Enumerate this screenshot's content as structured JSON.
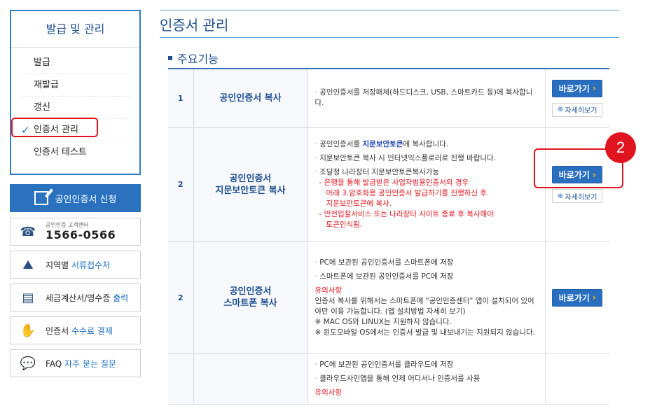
{
  "sidebar": {
    "title": "발급 및 관리",
    "items": [
      {
        "label": "발급"
      },
      {
        "label": "재발급"
      },
      {
        "label": "갱신"
      },
      {
        "label": "인증서 관리"
      },
      {
        "label": "인증서 테스트"
      }
    ],
    "active_mark": "✓",
    "apply_button": "공인인증서 신청",
    "callcenter": {
      "label": "공인인증 고객센터",
      "number": "1566-0566"
    },
    "links": [
      {
        "text": "지역별 ",
        "highlight": "서류접수처"
      },
      {
        "text": "세금계산서/영수증 ",
        "highlight": "출력"
      },
      {
        "text": "인증서 ",
        "highlight": "수수료 결제"
      },
      {
        "text": "FAQ ",
        "highlight": "자주 묻는 질문"
      }
    ]
  },
  "main": {
    "title": "인증서 관리",
    "section": "주요기능",
    "go_label": "바로가기",
    "go_arrow": "›",
    "detail_label": "자세히보기",
    "rows": [
      {
        "num": "1",
        "name": "공인인증서 복사",
        "desc": "공인인증서를 저장매체(하드디스크, USB, 스마트카드 등)에 복사합니다."
      },
      {
        "num": "2",
        "name1": "공인인증서",
        "name2": "지문보안토큰 복사",
        "d1a": "공인인증서를 ",
        "d1b": "지문보안토큰",
        "d1c": "에 복사합니다.",
        "d2": "지문보안토큰 복사 시 인터넷익스플로러로 진행 바랍니다.",
        "d3": "조달청 나라장터 지문보안토큰복사가능",
        "r1": "- 은행을 통해 발급받은 사업자범용인증서의 경우",
        "r2": "아래 3.암호화용 공인인증서 발급하기를 진행하신 후",
        "r3": "지문보안토큰에 복사.",
        "r4": "- 안전입찰서비스 또는 나라장터 사이트 종료 후 복사해야",
        "r5": "토큰인식됨."
      },
      {
        "num": "2",
        "name1": "공인인증서",
        "name2": "스마트폰 복사",
        "d1": "PC에 보관된 공인인증서를 스마트폰에 저장",
        "d2": "스마트폰에 보관된 공인인증서를 PC에 저장",
        "note_title": "유의사항",
        "n1": "인증서 복사를 위해서는 스마트폰에 \"공인인증센터\" 앱이 설치되어 있어야만 이용 가능합니다. (앱 설치방법 자세히 보기)",
        "n2": "※ MAC OS와 LINUX는 지원하지 않습니다.",
        "n3": "※ 윈도모바일 OS에서는 인증서 발급 및 내보내기는 지원되지 않습니다."
      },
      {
        "d1": "PC에 보관된 공인인증서를 클라우드에 저장",
        "d2": "클라우드사인앱을 통해 언제 어디서나 인증서를 사용",
        "note_title": "유의사항"
      }
    ]
  },
  "annotation": {
    "badge": "2"
  },
  "colors": {
    "primary": "#2a6fbf",
    "title": "#1f4f8f",
    "highlight": "#e0141e"
  }
}
